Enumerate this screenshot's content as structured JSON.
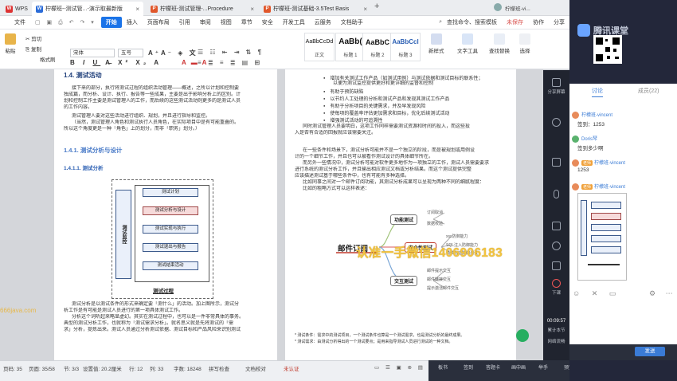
{
  "tabs": [
    {
      "app": "WPS",
      "label": "WPS"
    },
    {
      "label": "柠檬班--测试管...-演示取最新版",
      "active": true
    },
    {
      "label": "柠檬班-测试管理-...Procedure"
    },
    {
      "label": "柠檬班-测试基础-3.5Test Basis"
    }
  ],
  "titlebar_right": "柠檬班-vi...",
  "menus": [
    "文件",
    "开始",
    "插入",
    "页面布局",
    "引用",
    "审阅",
    "视图",
    "章节",
    "安全",
    "开发工具",
    "云服务",
    "文档助手"
  ],
  "menu_active": "开始",
  "search_placeholder": "查找命令、搜索模板",
  "unsaved": "未保存",
  "collab": "协作",
  "share": "分享",
  "ribbon": {
    "paste": "粘贴",
    "cut": "剪切",
    "copy": "复制",
    "format_painter": "格式刷",
    "font": "宋体",
    "font_size": "五号",
    "styles": [
      {
        "preview": "AaBbCcDd",
        "name": "正文"
      },
      {
        "preview": "AaBb(",
        "name": "标题 1"
      },
      {
        "preview": "AaBbC",
        "name": "标题 2"
      },
      {
        "preview": "AaBbCcl",
        "name": "标题 3"
      }
    ],
    "new_style": "新样式",
    "text_tool": "文字工具",
    "find_replace": "查找替换",
    "select": "选择"
  },
  "doc_left": {
    "heading": "1.4.  测试活动",
    "para1": [
      "接下来的部分，执行将测试过程的组织活动管理——概述，之所以计划和控制要",
      "独成篇，而分析、设计、执行、报告等一些成果，主要是出于影响分析上的区别。计",
      "划和控制工作主要是测试管理人的工作，而后续的这些测试活动则更多的是测试人员",
      "的工作内容。"
    ],
    "para2": [
      "测试管理人要对这些活动进行组织、规划，并且进行指导和监控。",
      "（当然，测试管理人角色和测试执行人员角色，在实际项目中是有可能重叠的。",
      "所以这个角度更是一种「角色」上的划分，而非「职务」划分。）"
    ],
    "sub1": "1.4.1.  测试分析与设计",
    "sub2": "1.4.1.1.  测试分析",
    "diagram": {
      "side_label": "测试监控",
      "boxes": [
        "测试计划",
        "测试分析与设计",
        "测试实现与执行",
        "测试退出与报告",
        "测试结束活动"
      ],
      "caption": "测试过程"
    },
    "para3": [
      "测试分析是以测试条件的形式来确定要「测什么」的活动。加上图所示，测试分",
      "析工作是有可能是测试人员进行的第一项具体测试工作。",
      "分析这个词听起来略显虚幻。其实在测试过程中，也可以是一件非常具体的事务。",
      "典型的测试分析工作，也就称为「测试需求分析」。就名思义就是先将测试的「需",
      "求」分析，提炼出来。测试人员通过分析测试依据、测试目标和产品风险来识别测试"
    ]
  },
  "doc_right": {
    "bullets": [
      "增加有关测试工作产品（如测试用例）与测试依据和测试目标的联系性；",
      "以便为测试监控提供更好和更详细的监督和控制",
      "有助于预防缺陷",
      "以节约人工处理的分析和测试产品和发现其测试工作产品",
      "有助于分析项目的关键需求，并及早发现风险",
      "使每项的覆盖率评估更加需求和目标，优化后续测试活动",
      "增强测试活动的可追溯性"
    ],
    "para1": [
      "同时测试管理人员要明白，这项工作同样需要测试资源和时间的投入，而这些投",
      "入是否有合适的回报就应该需要关注。"
    ],
    "para2": [
      "在一些条件和场景下，测试分析可能并不是一个独立的阶段，而是被规划或用例设",
      "计的一个细节工作，并且也可以被看作测试设计的具体细节所在。",
      "而另外一些情况中，测试分析可能对软件更多地作为一项独立的工作，测试人员需要要求",
      "进行系统的测试分析工作，并且输出相应测试文档或分析结果。而这个测试提供完整",
      "应该描述测试基于哪些条件中，也有可能有多种选择。",
      "比如同事之间对一个邮件订阅功能，其测试分析成果可以呈现为两种不同的细腻程度：",
      "比如的粗略方式可以这样表述："
    ],
    "mindmap": {
      "center": "邮件订阅",
      "nodes": [
        {
          "name": "功能测试",
          "leaves": [
            "订阅取消",
            "数据校验"
          ]
        },
        {
          "name": "安全性测试",
          "leaves": [
            "xss防御能力",
            "SQL注入防御能力",
            "请求伪造防御测试"
          ]
        },
        {
          "name": "交互测试",
          "leaves": [
            "邮件提示交互",
            "邮件链接交互",
            "提示激活邮件交互"
          ]
        }
      ]
    },
    "footnote": [
      "* 测试条件：需求中的测试项目，一个测试条件也算是一个测试需求，也是测试分析的最终成果。",
      "* 测试需求：由测试分析得出的一个测试要点；是用来指导测试人员进行测试的一种文档。"
    ]
  },
  "watermark": "认准一手微信1406906183",
  "watermark_site": "666java.com",
  "status": {
    "page_no": "页码: 35",
    "page": "页面: 35/58",
    "section": "节: 3/3",
    "position": "设置值: 20.2厘米",
    "row": "行: 12",
    "col": "列: 33",
    "words": "字数: 18248",
    "spell": "拼写检查",
    "proof": "文档校对",
    "cert": "未认证"
  },
  "live": {
    "app": "腾讯课堂",
    "share_label": "分享屏幕",
    "tabs": [
      "讨论",
      "成员(22)"
    ],
    "messages": [
      {
        "name": "柠檬班-vincent",
        "text": "签到：1253",
        "badge": ""
      },
      {
        "name": "Doris琴",
        "text": "签到多少啊",
        "badge": ""
      },
      {
        "name": "柠檬班-vincent",
        "text": "1253",
        "badge": "老师"
      },
      {
        "name": "柠檬班-vincent",
        "text": "",
        "badge": "老师"
      }
    ],
    "sidebar": [
      "分享屏幕",
      "直播",
      "摄像头",
      "麦克风",
      "声音",
      "音乐",
      "举手",
      "下课"
    ],
    "timer": "00:09:57",
    "timer_label": "累计本节",
    "data_label": "网络流畅",
    "send": "发送",
    "bottom_bar": [
      "板书",
      "签到",
      "答题卡",
      "画中画",
      "举手",
      "预览",
      "工具"
    ]
  }
}
